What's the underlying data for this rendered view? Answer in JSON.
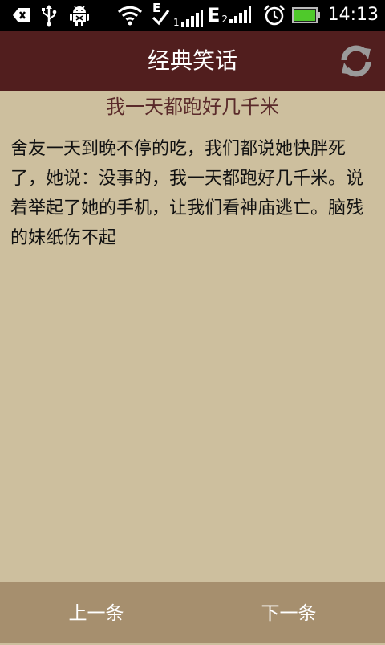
{
  "status_bar": {
    "time": "14:13",
    "network_1": "E",
    "network_1_sub": "1",
    "network_2": "E",
    "network_2_sub": "2",
    "icons": [
      "back-icon",
      "usb-icon",
      "android-debug-icon",
      "wifi-icon",
      "data-transfer-icon",
      "signal-icon",
      "alarm-icon",
      "battery-icon"
    ],
    "battery_color": "#4fc92b"
  },
  "header": {
    "title": "经典笑话",
    "refresh_icon": "refresh-icon",
    "background": "#511e1e"
  },
  "joke": {
    "title": "我一天都跑好几千米",
    "body": "舍友一天到晚不停的吃，我们都说她快胖死了，她说：没事的，我一天都跑好几千米。说着举起了她的手机，让我们看神庙逃亡。脑残的妹纸伤不起"
  },
  "bottom_bar": {
    "prev_label": "上一条",
    "next_label": "下一条"
  },
  "colors": {
    "content_bg": "#cdbf9e",
    "bottom_bg": "#a68f6e",
    "title_text": "#5a2a2a"
  }
}
